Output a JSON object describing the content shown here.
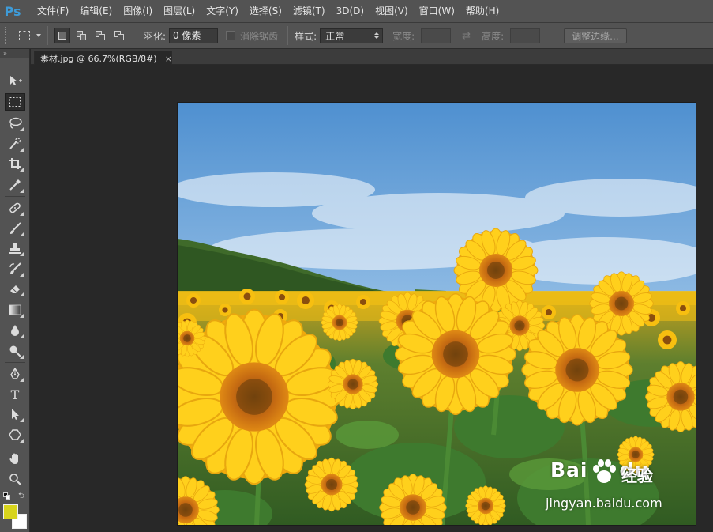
{
  "app": {
    "logo": "Ps",
    "accent_color": "#3e9bd8"
  },
  "menu": [
    "文件(F)",
    "编辑(E)",
    "图像(I)",
    "图层(L)",
    "文字(Y)",
    "选择(S)",
    "滤镜(T)",
    "3D(D)",
    "视图(V)",
    "窗口(W)",
    "帮助(H)"
  ],
  "options": {
    "feather_label": "羽化:",
    "feather_value": "0 像素",
    "antialias_label": "消除锯齿",
    "style_label": "样式:",
    "style_value": "正常",
    "width_label": "宽度:",
    "height_label": "高度:",
    "refine_edge_label": "调整边缘..."
  },
  "toolbar": {
    "collapse_glyph": "»",
    "tools": [
      "move-tool",
      "rectangular-marquee-tool",
      "lasso-tool",
      "quick-selection-tool",
      "crop-tool",
      "eyedropper-tool",
      "spot-healing-brush-tool",
      "brush-tool",
      "clone-stamp-tool",
      "history-brush-tool",
      "eraser-tool",
      "gradient-tool",
      "blur-tool",
      "dodge-tool",
      "pen-tool",
      "type-tool",
      "path-selection-tool",
      "shape-tool",
      "hand-tool",
      "zoom-tool"
    ],
    "type_tool_glyph": "T",
    "foreground_color": "#d8d41c",
    "background_color": "#ffffff"
  },
  "document": {
    "tab_title": "素材.jpg @ 66.7%(RGB/8#)",
    "close_glyph": "×"
  },
  "watermark": {
    "brand": "Bai",
    "brand_suffix": "du",
    "cn_label": "经验",
    "url": "jingyan.baidu.com"
  }
}
